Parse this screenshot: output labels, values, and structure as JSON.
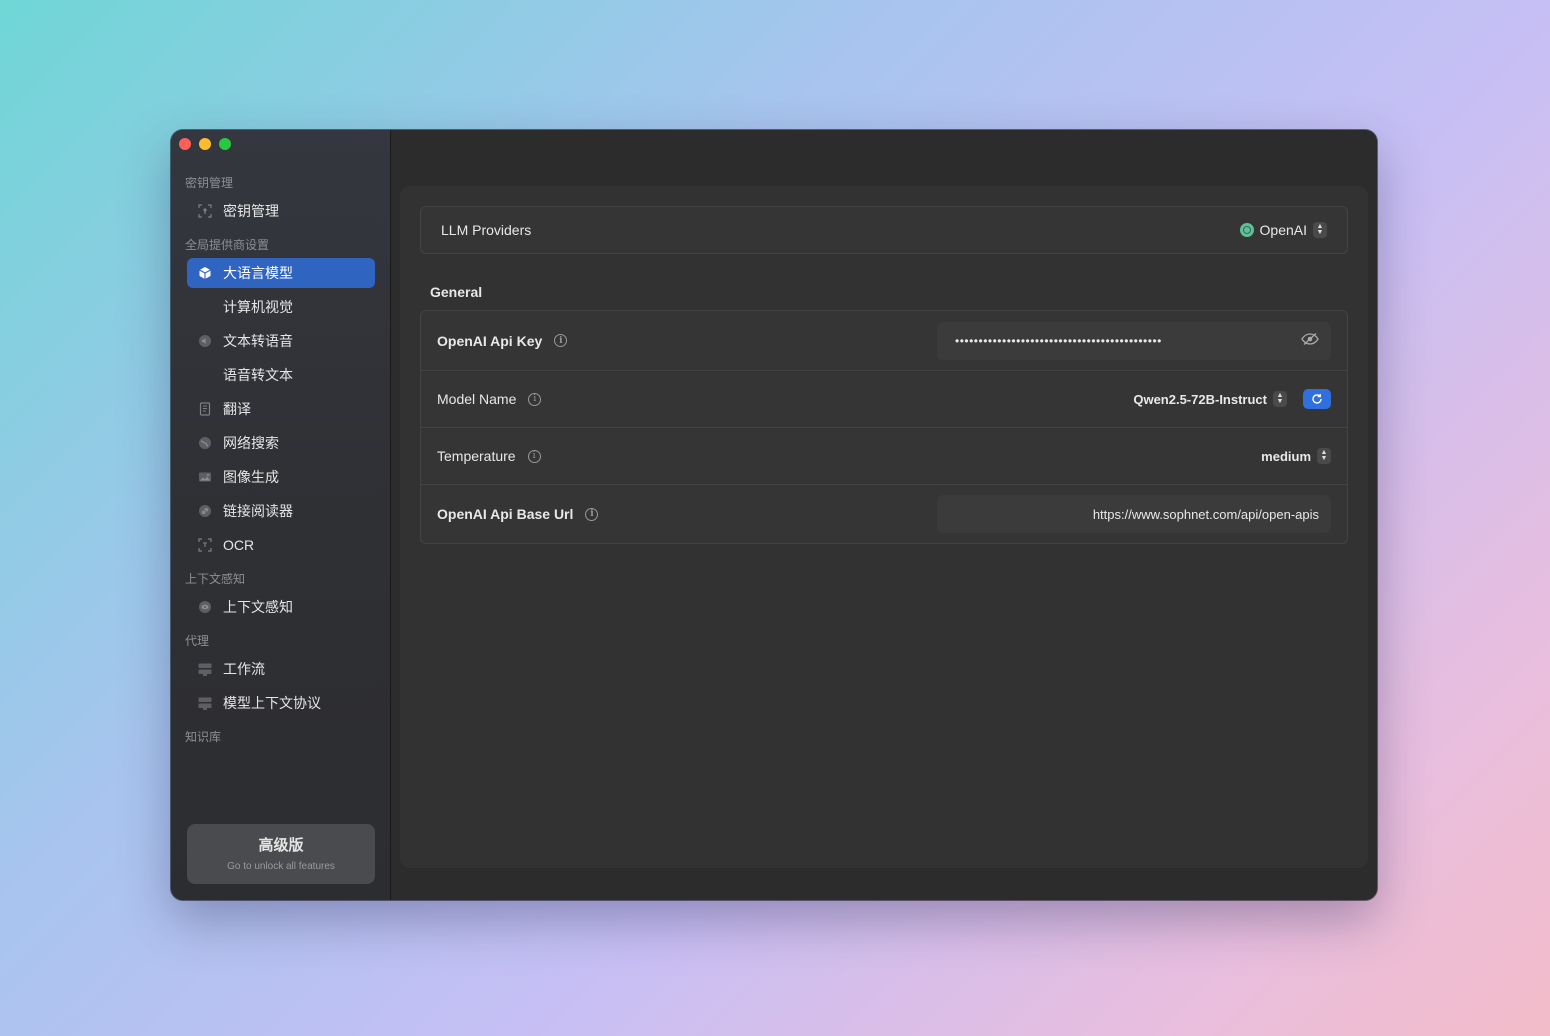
{
  "sidebar": {
    "sections": [
      {
        "label": "密钥管理",
        "items": [
          {
            "label": "密钥管理",
            "icon": "key-scan-icon"
          }
        ]
      },
      {
        "label": "全局提供商设置",
        "items": [
          {
            "label": "大语言模型",
            "icon": "cube-icon",
            "active": true
          },
          {
            "label": "计算机视觉",
            "icon": ""
          },
          {
            "label": "文本转语音",
            "icon": "speaker-icon"
          },
          {
            "label": "语音转文本",
            "icon": ""
          },
          {
            "label": "翻译",
            "icon": "book-icon"
          },
          {
            "label": "网络搜索",
            "icon": "globe-icon"
          },
          {
            "label": "图像生成",
            "icon": "photo-icon"
          },
          {
            "label": "链接阅读器",
            "icon": "link-icon"
          },
          {
            "label": "OCR",
            "icon": "text-scan-icon"
          }
        ]
      },
      {
        "label": "上下文感知",
        "items": [
          {
            "label": "上下文感知",
            "icon": "eye-icon"
          }
        ]
      },
      {
        "label": "代理",
        "items": [
          {
            "label": "工作流",
            "icon": "workflow-icon"
          },
          {
            "label": "模型上下文协议",
            "icon": "server-icon"
          }
        ]
      },
      {
        "label": "知识库",
        "items": []
      }
    ],
    "premium": {
      "title": "高级版",
      "subtitle": "Go to unlock all features"
    }
  },
  "main": {
    "provider": {
      "label": "LLM Providers",
      "value": "OpenAI"
    },
    "general": {
      "title": "General",
      "api_key": {
        "label": "OpenAI Api Key",
        "value": "••••••••••••••••••••••••••••••••••••••••••••"
      },
      "model_name": {
        "label": "Model Name",
        "value": "Qwen2.5-72B-Instruct"
      },
      "temperature": {
        "label": "Temperature",
        "value": "medium"
      },
      "base_url": {
        "label": "OpenAI Api Base Url",
        "value": "https://www.sophnet.com/api/open-apis"
      }
    }
  },
  "colors": {
    "accent": "#2f64c0",
    "button": "#2f6fde"
  }
}
